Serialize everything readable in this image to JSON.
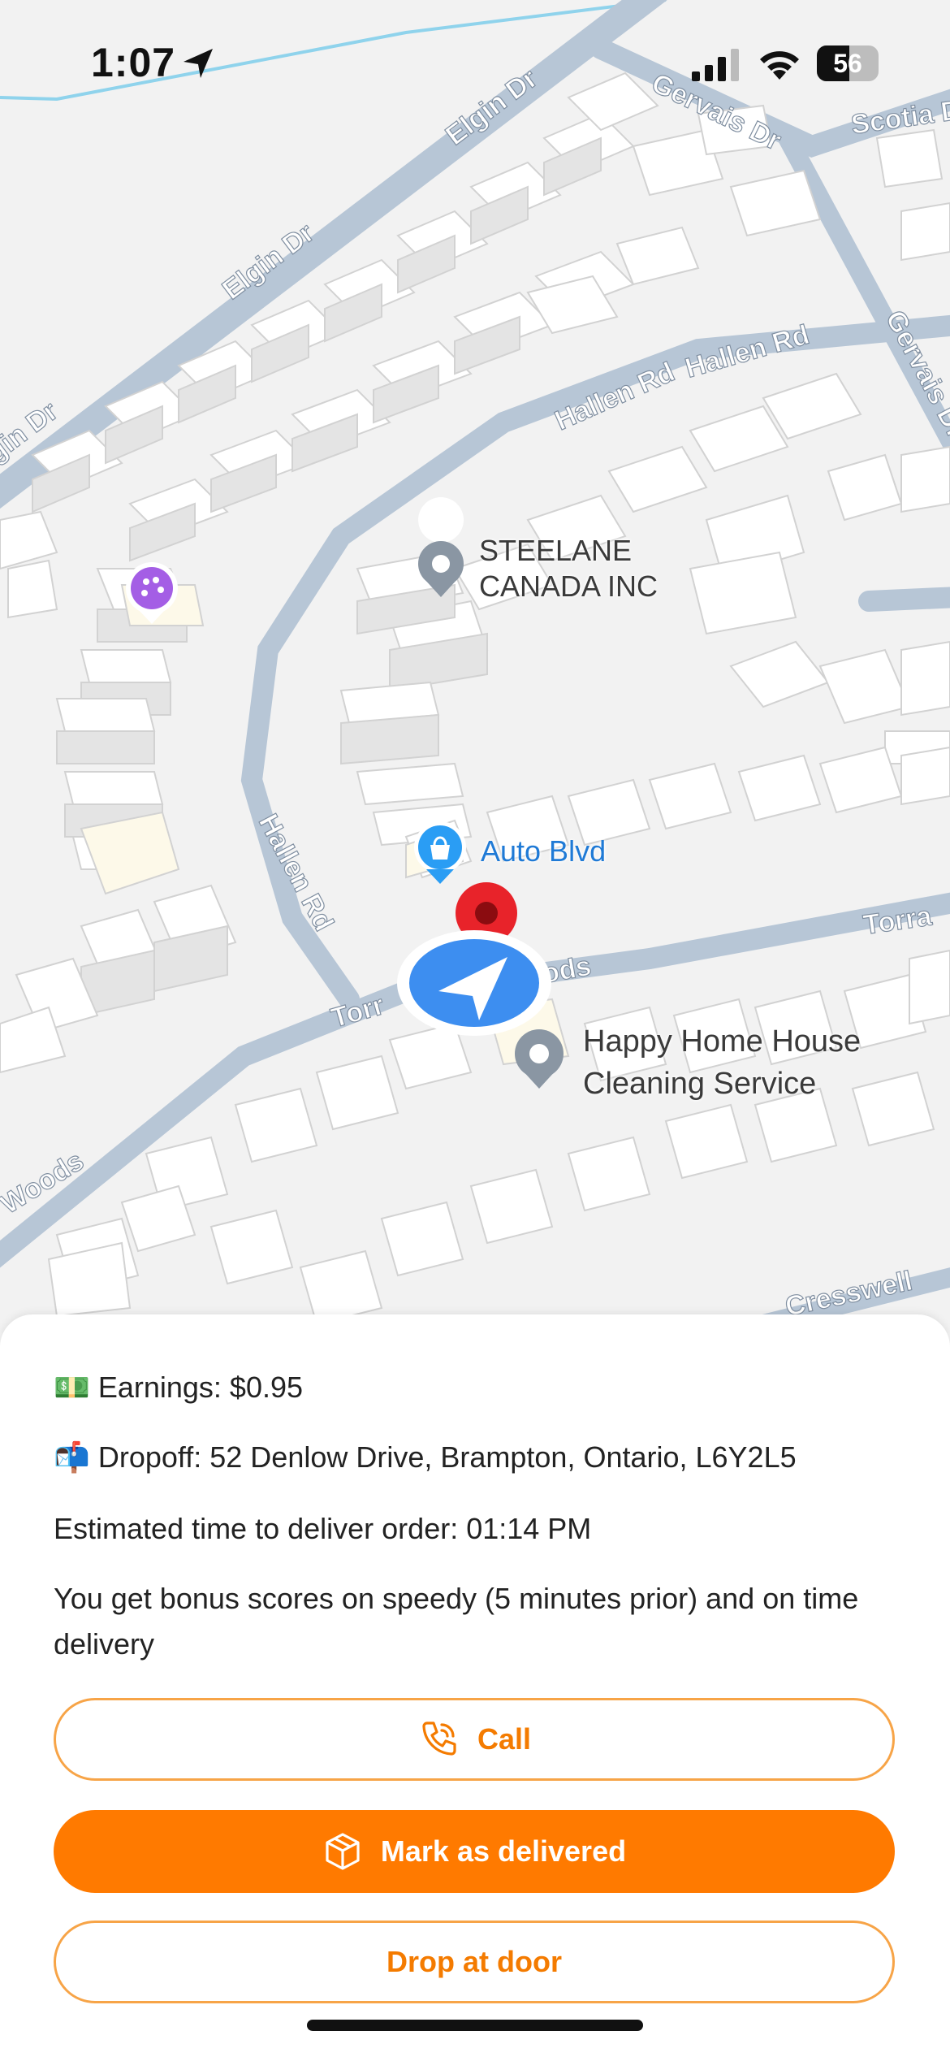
{
  "status_bar": {
    "time": "1:07",
    "battery": "56"
  },
  "map": {
    "streets": {
      "elgin_dr_1": "Elgin Dr",
      "elgin_dr_2": "Elgin Dr",
      "elgin_dr_3": "gin Dr",
      "gervais_dr_1": "Gervais Dr",
      "gervais_dr_2": "Gervais Dr",
      "scotia": "Scotia D",
      "hallen_rd_1": "Hallen Rd",
      "hallen_rd_2": "Hallen Rd",
      "hallen_rd_3": "Hallen Rd",
      "torrance_1": "Torra",
      "torrance_2": "Torr",
      "torrance_3": "ods",
      "woods": "Woods",
      "cresswell": "Cresswell"
    },
    "pois": {
      "steelane": "STEELANE\nCANADA INC",
      "auto_blvd": "Auto Blvd",
      "happy_home": "Happy Home House\nCleaning Service"
    }
  },
  "order": {
    "earnings_emoji": "💵",
    "earnings": "Earnings: $0.95",
    "dropoff_emoji": "📬",
    "dropoff": "Dropoff: 52 Denlow Drive, Brampton, Ontario, L6Y2L5",
    "eta": "Estimated time to deliver order: 01:14 PM",
    "bonus": "You get bonus scores on speedy (5 minutes prior) and on time delivery"
  },
  "actions": {
    "call": "Call",
    "mark_delivered": "Mark as delivered",
    "drop_at_door": "Drop at door"
  },
  "colors": {
    "accent": "#ff7a00",
    "location": "#3d8ef0",
    "destination": "#e8232a"
  }
}
